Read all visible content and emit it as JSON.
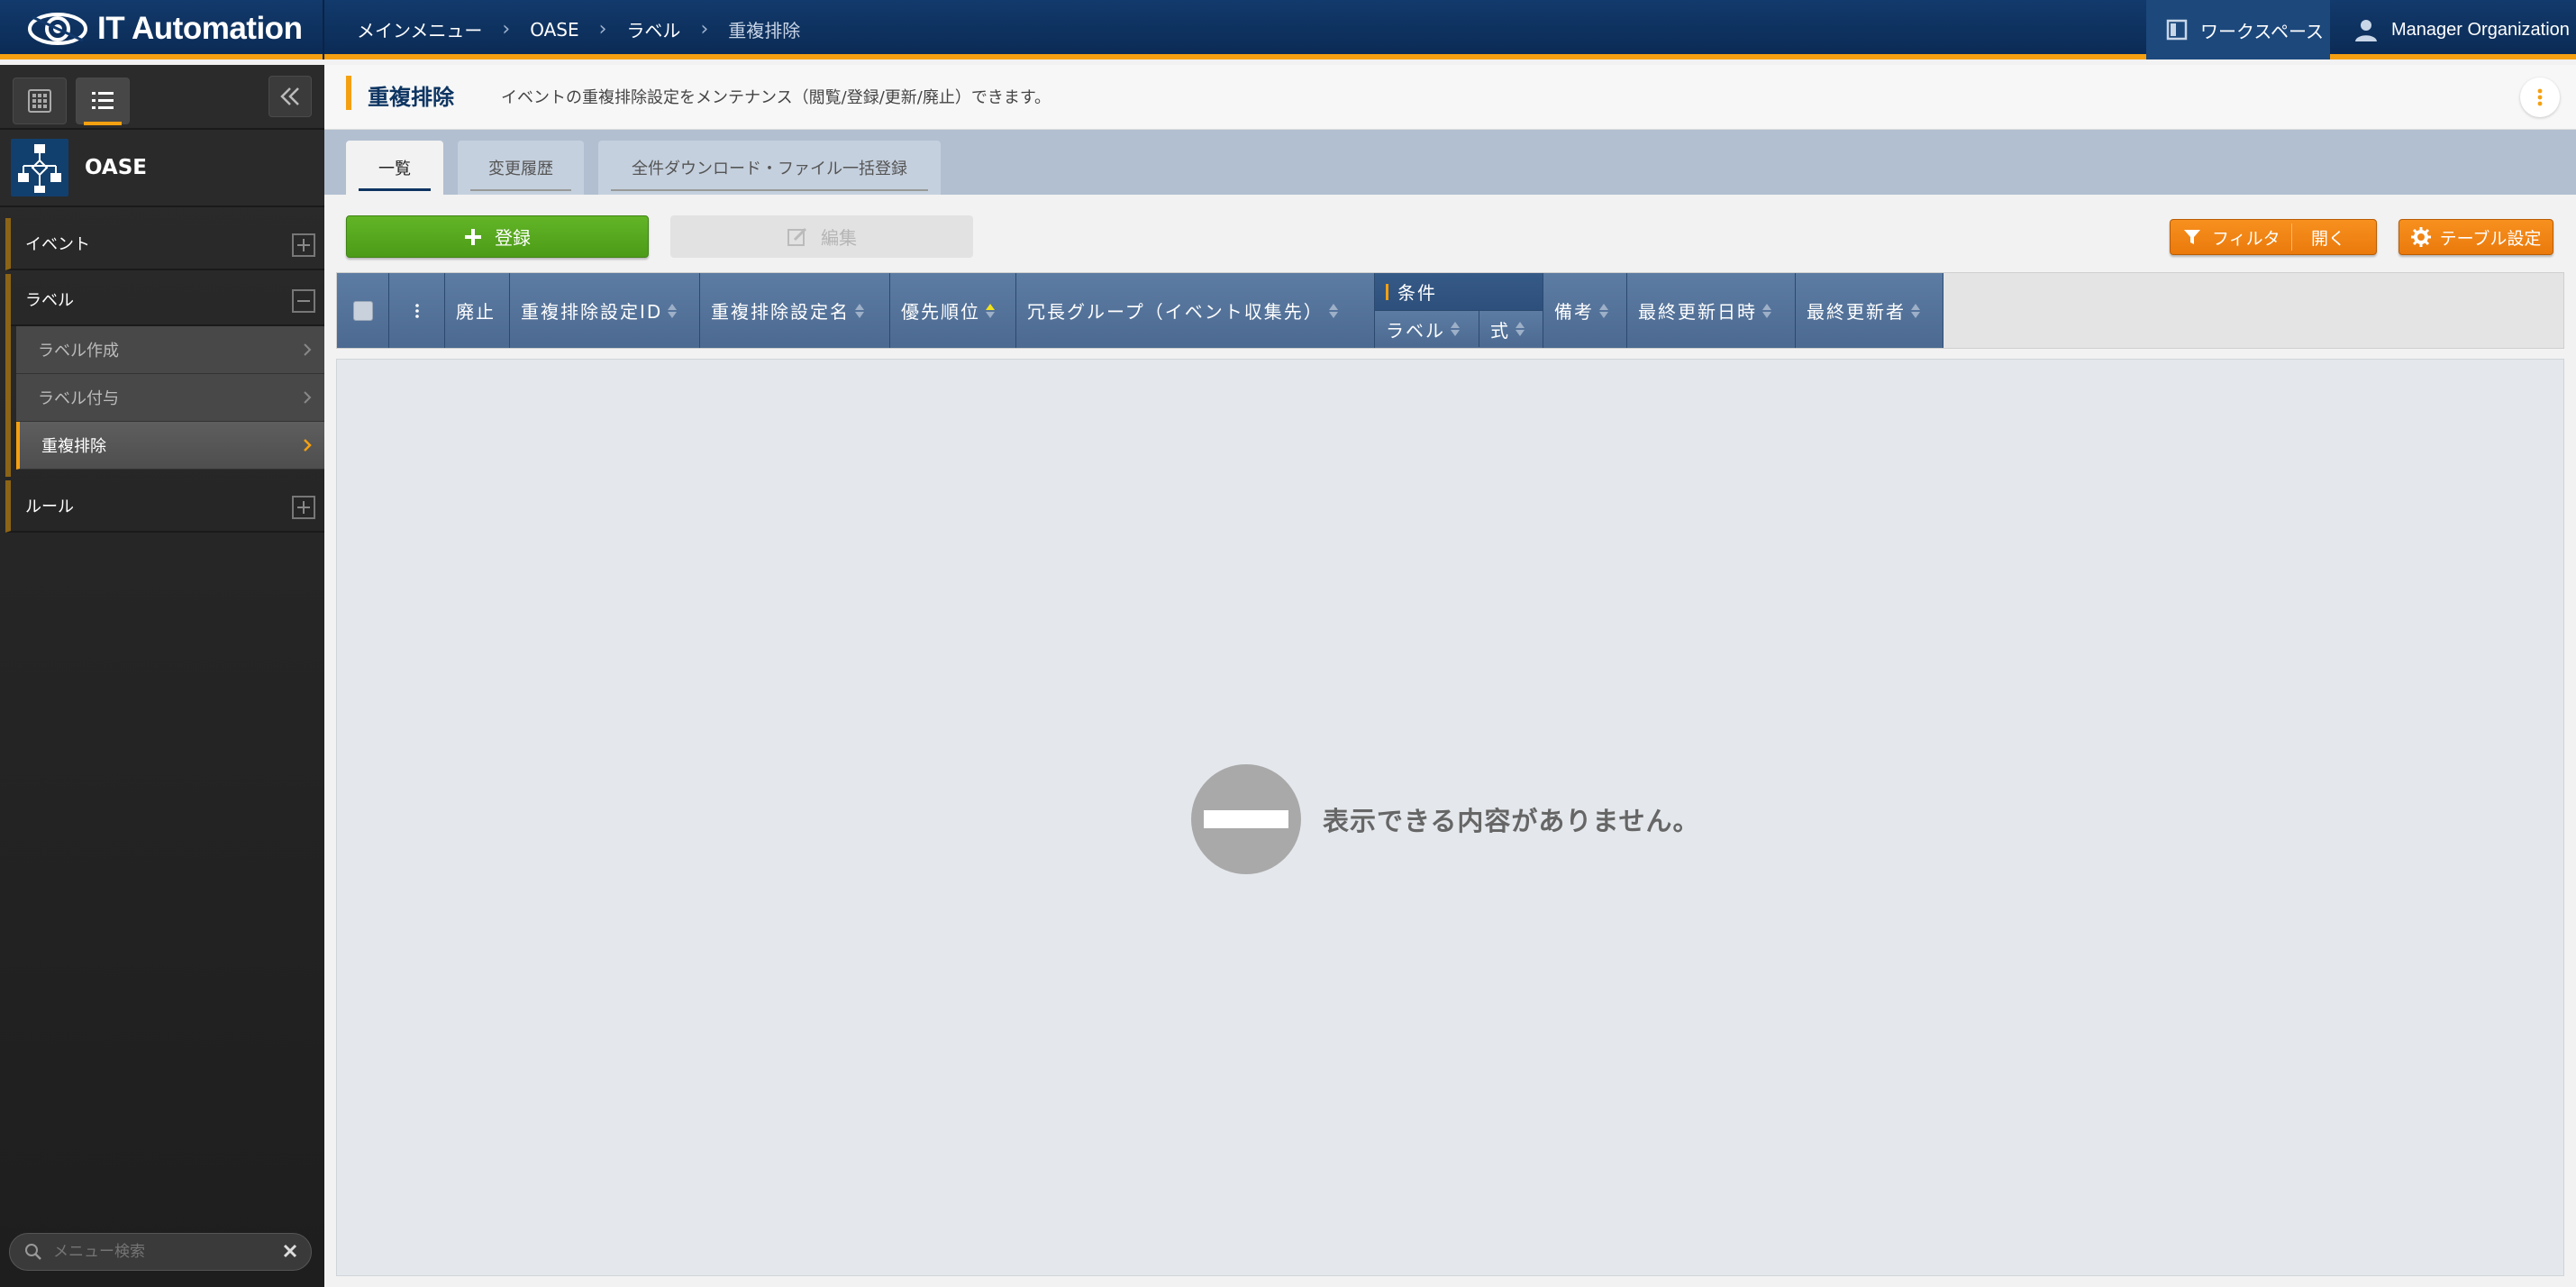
{
  "header": {
    "app_name": "IT Automation",
    "breadcrumb": [
      "メインメニュー",
      "OASE",
      "ラベル",
      "重複排除"
    ],
    "workspace_label": "ワークスペース",
    "user_label": "Manager Organization",
    "accent_color": "#f5a011"
  },
  "sidebar": {
    "menu_group_title": "OASE",
    "groups": [
      {
        "label": "イベント",
        "expanded": false,
        "items": []
      },
      {
        "label": "ラベル",
        "expanded": true,
        "items": [
          "ラベル作成",
          "ラベル付与",
          "重複排除"
        ]
      },
      {
        "label": "ルール",
        "expanded": false,
        "items": []
      }
    ],
    "active_item": "重複排除",
    "search_placeholder": "メニュー検索"
  },
  "page": {
    "title": "重複排除",
    "description": "イベントの重複排除設定をメンテナンス（閲覧/登録/更新/廃止）できます。"
  },
  "tabs": [
    {
      "label": "一覧",
      "active": true
    },
    {
      "label": "変更履歴",
      "active": false
    },
    {
      "label": "全件ダウンロード・ファイル一括登録",
      "active": false
    }
  ],
  "toolbar": {
    "register_label": "登録",
    "edit_label": "編集",
    "filter_label": "フィルタ",
    "filter_open_label": "開く",
    "table_settings_label": "テーブル設定"
  },
  "table": {
    "columns": {
      "discard": "廃止",
      "dedup_id": "重複排除設定ID",
      "dedup_name": "重複排除設定名",
      "priority": "優先順位",
      "redundancy_group": "冗長グループ（イベント収集先）",
      "condition": "条件",
      "condition_label": "ラベル",
      "condition_expr": "式",
      "remarks": "備考",
      "last_updated": "最終更新日時",
      "last_updated_by": "最終更新者"
    },
    "rows": [],
    "empty_message": "表示できる内容がありません。"
  }
}
